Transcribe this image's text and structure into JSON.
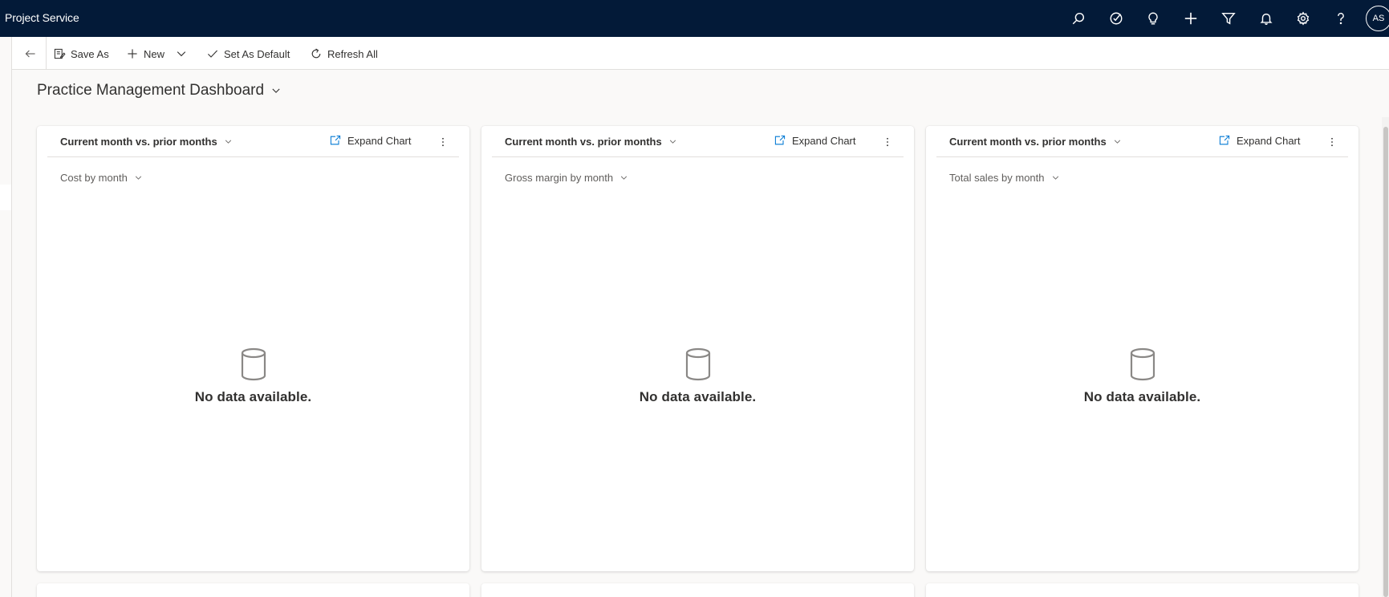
{
  "app": {
    "title": "Project Service"
  },
  "topbar": {
    "icons": [
      "search-icon",
      "task-icon",
      "lightbulb-icon",
      "add-icon",
      "filter-icon",
      "notification-icon",
      "settings-icon",
      "help-icon"
    ],
    "user_initials": "AS"
  },
  "commandbar": {
    "save_as": "Save As",
    "new": "New",
    "set_default": "Set As Default",
    "refresh_all": "Refresh All"
  },
  "dashboard": {
    "title": "Practice Management Dashboard"
  },
  "cards": [
    {
      "view": "Current month vs. prior months",
      "expand": "Expand Chart",
      "chart": "Cost by month",
      "empty": "No data available."
    },
    {
      "view": "Current month vs. prior months",
      "expand": "Expand Chart",
      "chart": "Gross margin by month",
      "empty": "No data available."
    },
    {
      "view": "Current month vs. prior months",
      "expand": "Expand Chart",
      "chart": "Total sales by month",
      "empty": "No data available."
    }
  ],
  "colors": {
    "nav_bg": "#031a38",
    "accent": "#0078d4",
    "page_bg": "#faf9f8"
  }
}
